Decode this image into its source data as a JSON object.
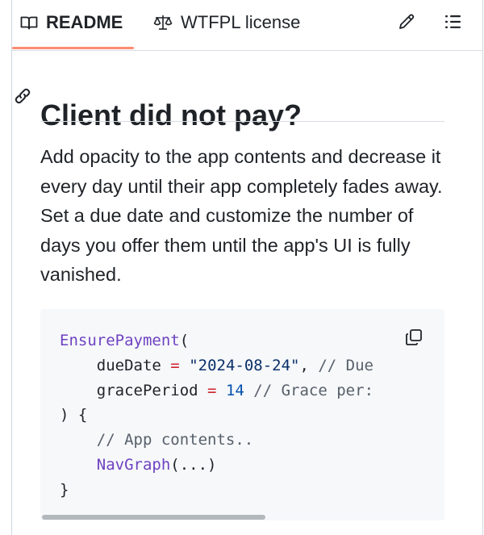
{
  "tabs": {
    "readme_label": "README",
    "license_label": "WTFPL license",
    "readme_icon": "book-icon",
    "license_icon": "scale-icon"
  },
  "toolbar": {
    "edit_icon": "pencil-icon",
    "outline_icon": "list-icon"
  },
  "heading": {
    "title": "Client did not pay?",
    "anchor_icon": "link-icon"
  },
  "paragraph": "Add opacity to the app contents and decrease it every day until their app completely fades away. Set a due date and customize the number of days you offer them until the app's UI is fully vanished.",
  "code": {
    "lines": [
      {
        "indent": "",
        "parts": [
          [
            "fn",
            "EnsurePayment"
          ],
          [
            "",
            "("
          ]
        ]
      },
      {
        "indent": "    ",
        "parts": [
          [
            "",
            "dueDate "
          ],
          [
            "op",
            "="
          ],
          [
            "",
            " "
          ],
          [
            "str",
            "\"2024-08-24\""
          ],
          [
            "",
            ", "
          ],
          [
            "cmt",
            "// Due"
          ]
        ]
      },
      {
        "indent": "    ",
        "parts": [
          [
            "",
            "gracePeriod "
          ],
          [
            "op",
            "="
          ],
          [
            "",
            " "
          ],
          [
            "num",
            "14"
          ],
          [
            "",
            " "
          ],
          [
            "cmt",
            "// Grace per:"
          ]
        ]
      },
      {
        "indent": "",
        "parts": [
          [
            "",
            ") {"
          ]
        ]
      },
      {
        "indent": "    ",
        "parts": [
          [
            "cmt",
            "// App contents.."
          ]
        ]
      },
      {
        "indent": "    ",
        "parts": [
          [
            "fn",
            "NavGraph"
          ],
          [
            "",
            "(...)"
          ]
        ]
      },
      {
        "indent": "",
        "parts": [
          [
            "",
            "}"
          ]
        ]
      }
    ],
    "copy_icon": "copy-icon"
  },
  "colors": {
    "tab_underline": "#fd8c73",
    "code_background": "#f6f8fa"
  }
}
